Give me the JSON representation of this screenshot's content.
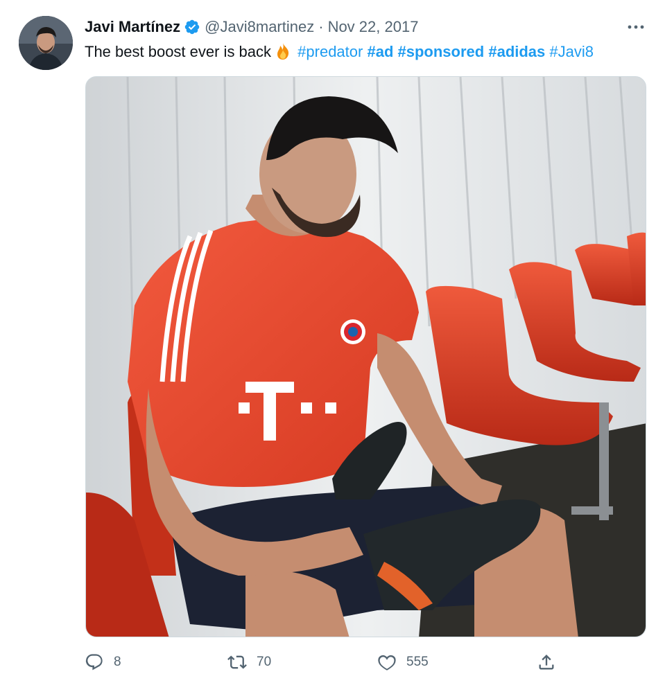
{
  "author": {
    "display_name": "Javi Martínez",
    "verified_icon": "verified-badge-icon",
    "handle": "@Javi8martinez",
    "separator": "·",
    "date": "Nov 22, 2017"
  },
  "tweet": {
    "text": "The best boost ever is back",
    "emoji": "fire-emoji",
    "hashtags": [
      "#predator",
      "#ad",
      "#sponsored",
      "#adidas",
      "#Javi8"
    ]
  },
  "actions": {
    "reply_count": "8",
    "retweet_count": "70",
    "like_count": "555"
  },
  "colors": {
    "link": "#1d9bf0",
    "secondary_text": "#536471",
    "jersey": "#e8412b",
    "seats": "#d8351f"
  },
  "icons": [
    "more-icon",
    "reply-icon",
    "retweet-icon",
    "like-icon",
    "share-icon"
  ]
}
